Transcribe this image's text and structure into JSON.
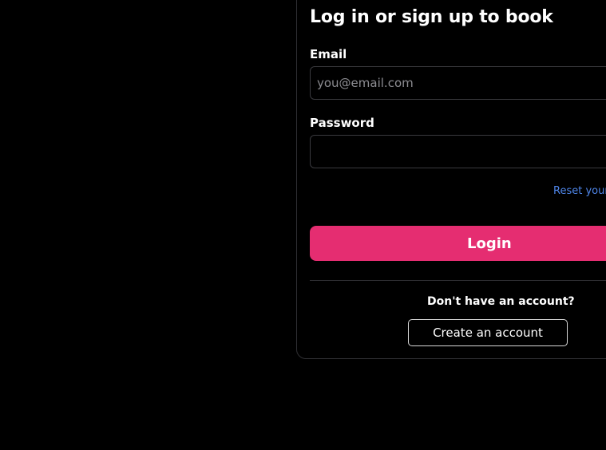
{
  "form": {
    "title": "Log in or sign up to book",
    "email_label": "Email",
    "email_placeholder": "you@email.com",
    "email_value": "",
    "password_label": "Password",
    "password_value": "",
    "reset_link": "Reset your",
    "login_button": "Login",
    "no_account_text": "Don't have an account?",
    "create_account_button": "Create an account"
  },
  "colors": {
    "background": "#000000",
    "accent": "#e52d71",
    "link": "#4f86ea",
    "border": "#3a3a3e"
  }
}
